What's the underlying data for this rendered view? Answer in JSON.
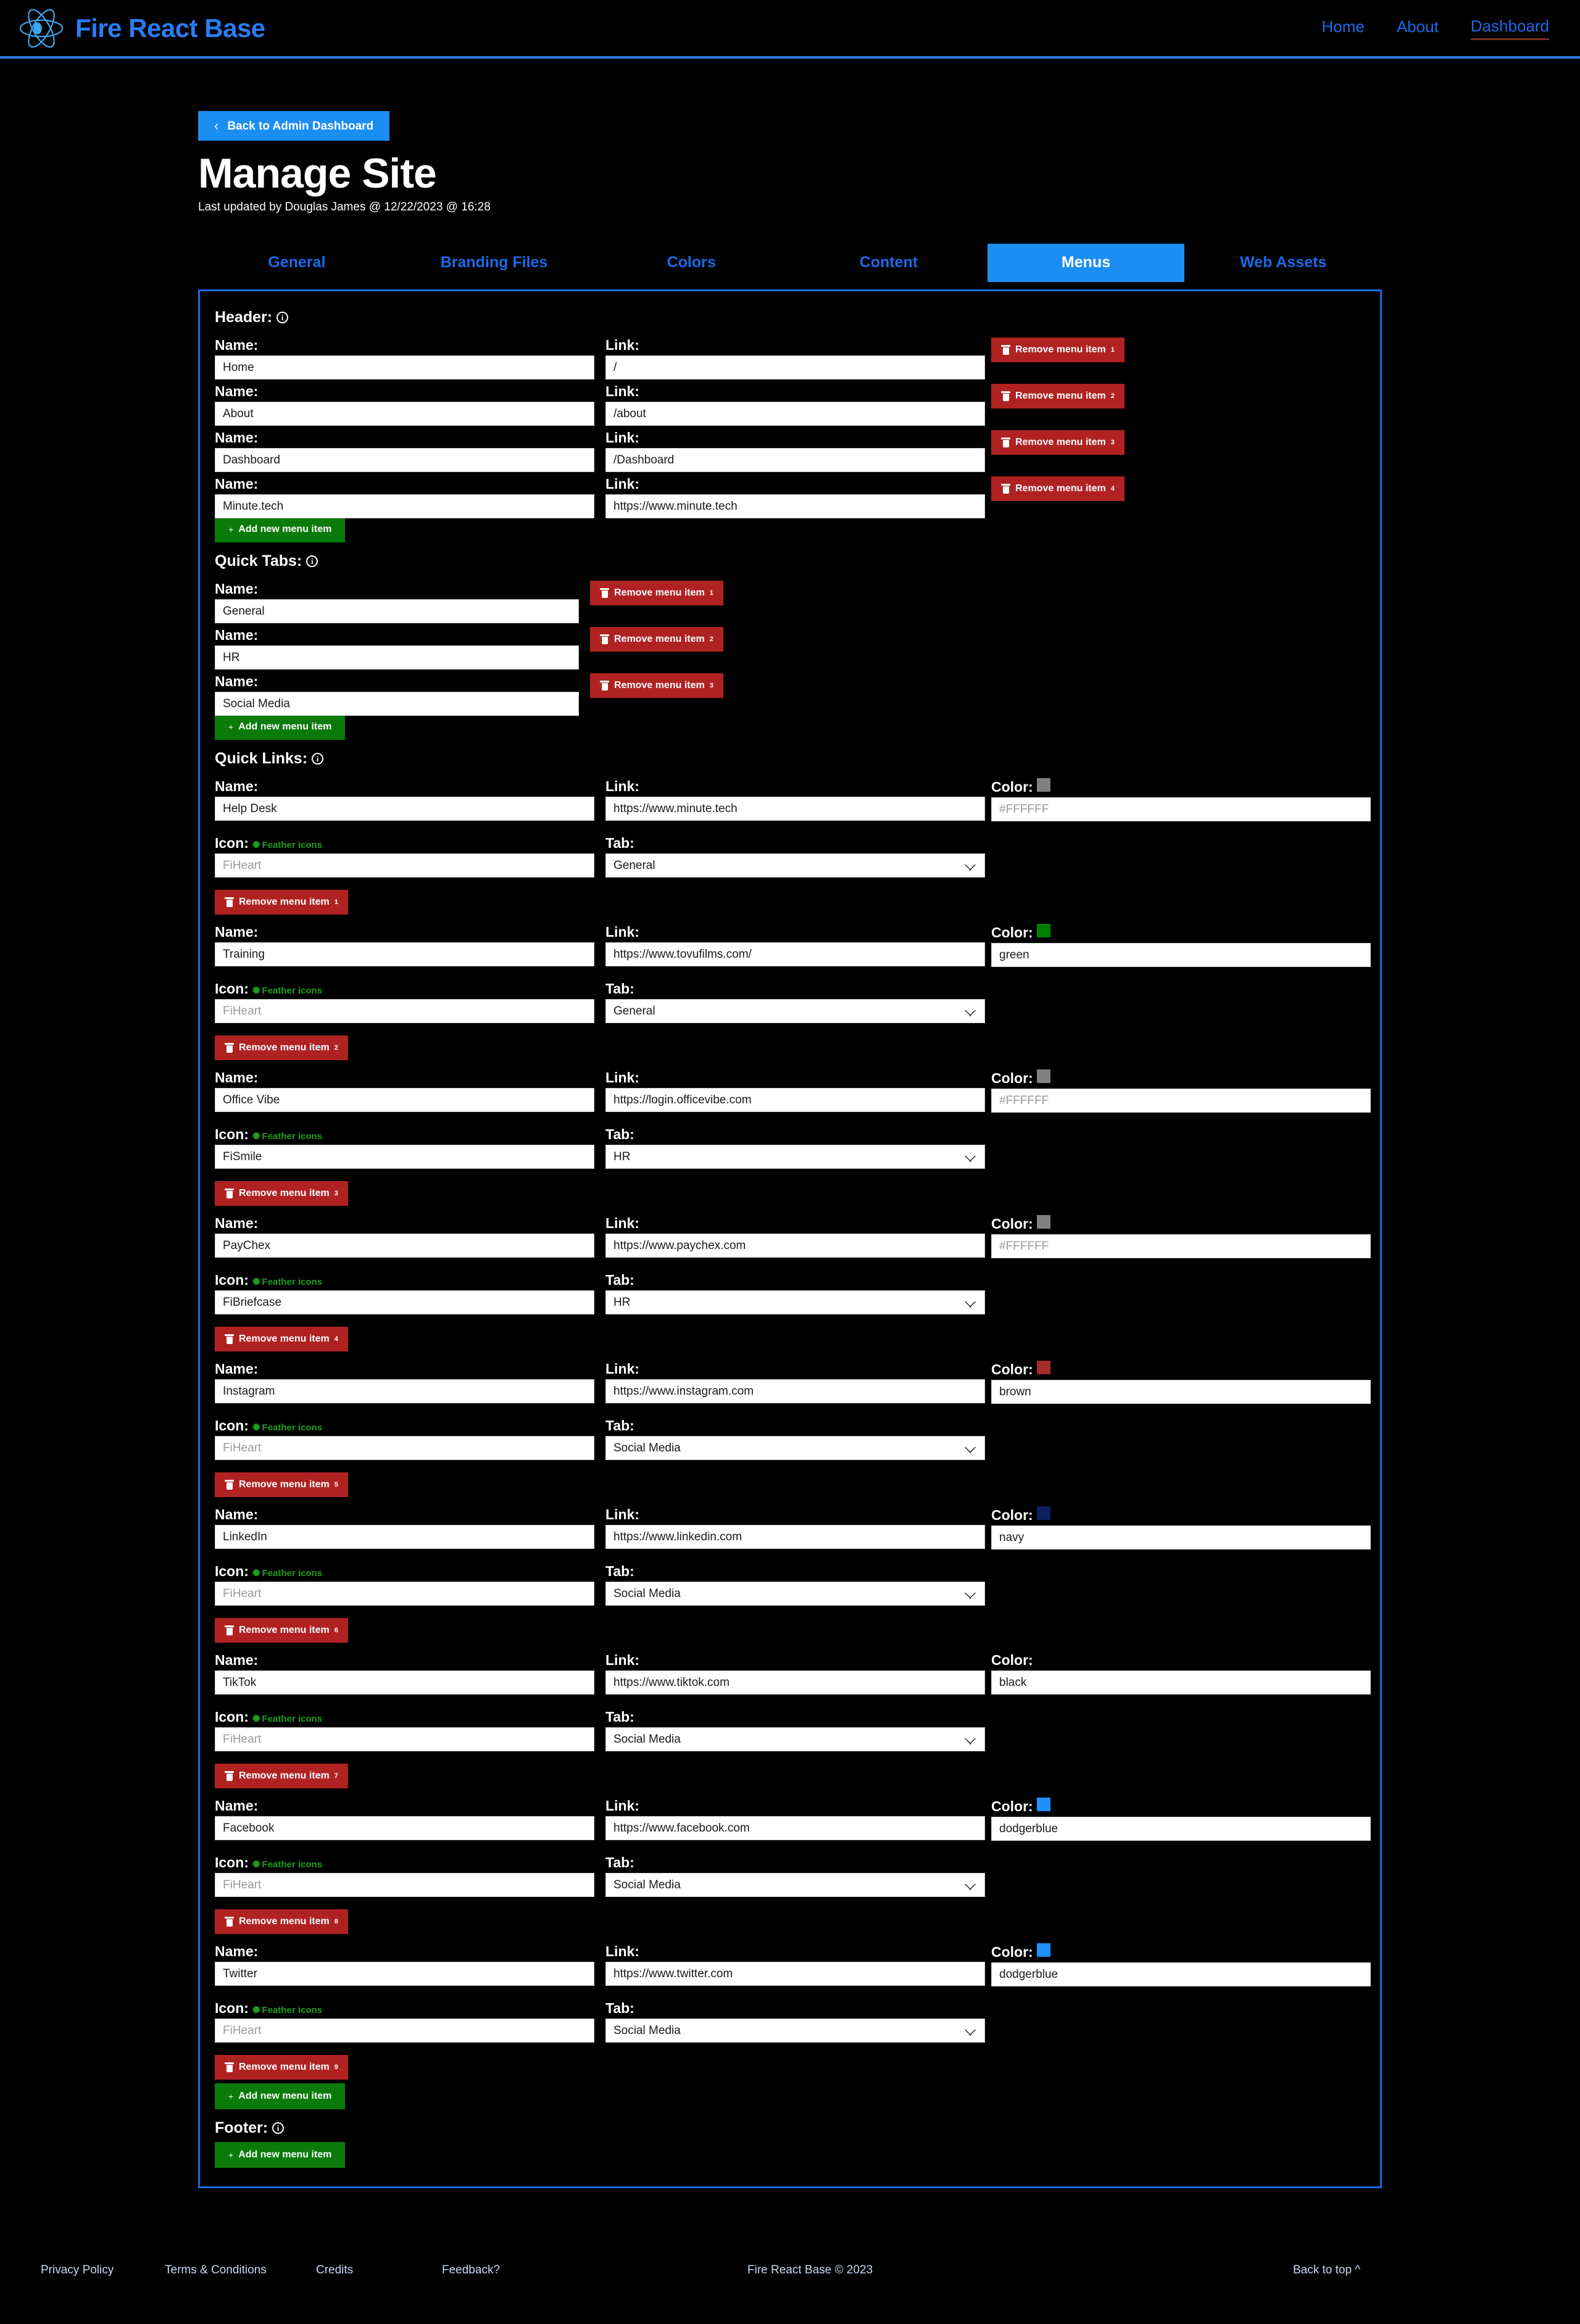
{
  "navbar": {
    "brand": "Fire React Base",
    "logo_icon": "react-atom-logo",
    "links": [
      {
        "label": "Home",
        "active": false
      },
      {
        "label": "About",
        "active": false
      },
      {
        "label": "Dashboard",
        "active": true
      }
    ]
  },
  "header": {
    "back_button": "Back to Admin Dashboard",
    "back_icon": "chevron-left-icon",
    "title": "Manage Site",
    "last_updated": "Last updated by Douglas James @ 12/22/2023 @ 16:28"
  },
  "tabs": [
    {
      "label": "General",
      "active": false
    },
    {
      "label": "Branding Files",
      "active": false
    },
    {
      "label": "Colors",
      "active": false
    },
    {
      "label": "Content",
      "active": false
    },
    {
      "label": "Menus",
      "active": true
    },
    {
      "label": "Web Assets",
      "active": false
    }
  ],
  "labels": {
    "name": "Name:",
    "link": "Link:",
    "icon": "Icon:",
    "tab": "Tab:",
    "color": "Color:",
    "feather_icons": "Feather icons",
    "add_new": "Add new menu item",
    "remove": "Remove menu item",
    "info_icon": "info-icon",
    "trash_icon": "trash-icon",
    "plus_icon": "plus-icon"
  },
  "sections": {
    "header_menu": {
      "title": "Header:",
      "items": [
        {
          "name": "Home",
          "link": "/"
        },
        {
          "name": "About",
          "link": "/about"
        },
        {
          "name": "Dashboard",
          "link": "/Dashboard"
        },
        {
          "name": "Minute.tech",
          "link": "https://www.minute.tech"
        }
      ]
    },
    "quick_tabs": {
      "title": "Quick Tabs:",
      "items": [
        {
          "name": "General"
        },
        {
          "name": "HR"
        },
        {
          "name": "Social Media"
        }
      ]
    },
    "quick_links": {
      "title": "Quick Links:",
      "tab_options": [
        "General",
        "HR",
        "Social Media"
      ],
      "items": [
        {
          "name": "Help Desk",
          "link": "https://www.minute.tech",
          "color_value": "",
          "color_placeholder": "#FFFFFF",
          "color_swatch": "#808080",
          "icon_value": "",
          "icon_placeholder": "FiHeart",
          "tab": "General"
        },
        {
          "name": "Training",
          "link": "https://www.tovufilms.com/",
          "color_value": "green",
          "color_placeholder": "#FFFFFF",
          "color_swatch": "#008000",
          "icon_value": "",
          "icon_placeholder": "FiHeart",
          "tab": "General"
        },
        {
          "name": "Office Vibe",
          "link": "https://login.officevibe.com",
          "color_value": "",
          "color_placeholder": "#FFFFFF",
          "color_swatch": "#808080",
          "icon_value": "FiSmile",
          "icon_placeholder": "FiHeart",
          "tab": "HR"
        },
        {
          "name": "PayChex",
          "link": "https://www.paychex.com",
          "color_value": "",
          "color_placeholder": "#FFFFFF",
          "color_swatch": "#808080",
          "icon_value": "FiBriefcase",
          "icon_placeholder": "FiHeart",
          "tab": "HR"
        },
        {
          "name": "Instagram",
          "link": "https://www.instagram.com",
          "color_value": "brown",
          "color_placeholder": "#FFFFFF",
          "color_swatch": "#a52a2a",
          "icon_value": "",
          "icon_placeholder": "FiHeart",
          "tab": "Social Media"
        },
        {
          "name": "LinkedIn",
          "link": "https://www.linkedin.com",
          "color_value": "navy",
          "color_placeholder": "#FFFFFF",
          "color_swatch": "#0d1f5c",
          "icon_value": "",
          "icon_placeholder": "FiHeart",
          "tab": "Social Media"
        },
        {
          "name": "TikTok",
          "link": "https://www.tiktok.com",
          "color_value": "black",
          "color_placeholder": "#FFFFFF",
          "color_swatch": "#000000",
          "icon_value": "",
          "icon_placeholder": "FiHeart",
          "tab": "Social Media"
        },
        {
          "name": "Facebook",
          "link": "https://www.facebook.com",
          "color_value": "dodgerblue",
          "color_placeholder": "#FFFFFF",
          "color_swatch": "#1e90ff",
          "icon_value": "",
          "icon_placeholder": "FiHeart",
          "tab": "Social Media"
        },
        {
          "name": "Twitter",
          "link": "https://www.twitter.com",
          "color_value": "dodgerblue",
          "color_placeholder": "#FFFFFF",
          "color_swatch": "#1e90ff",
          "icon_value": "",
          "icon_placeholder": "FiHeart",
          "tab": "Social Media"
        }
      ]
    },
    "footer_menu": {
      "title": "Footer:",
      "items": []
    }
  },
  "site_footer": {
    "links": [
      {
        "label": "Privacy Policy"
      },
      {
        "label": "Terms & Conditions"
      },
      {
        "label": "Credits"
      },
      {
        "label": "Feedback?"
      }
    ],
    "copyright": "Fire React Base © 2023",
    "back_to_top": "Back to top ^"
  },
  "colors": {
    "accent_blue": "#1b8ef2",
    "link_blue": "#1a6ae8",
    "danger_red": "#b02222",
    "success_green": "#0a7a0a",
    "page_bg": "#000000"
  }
}
